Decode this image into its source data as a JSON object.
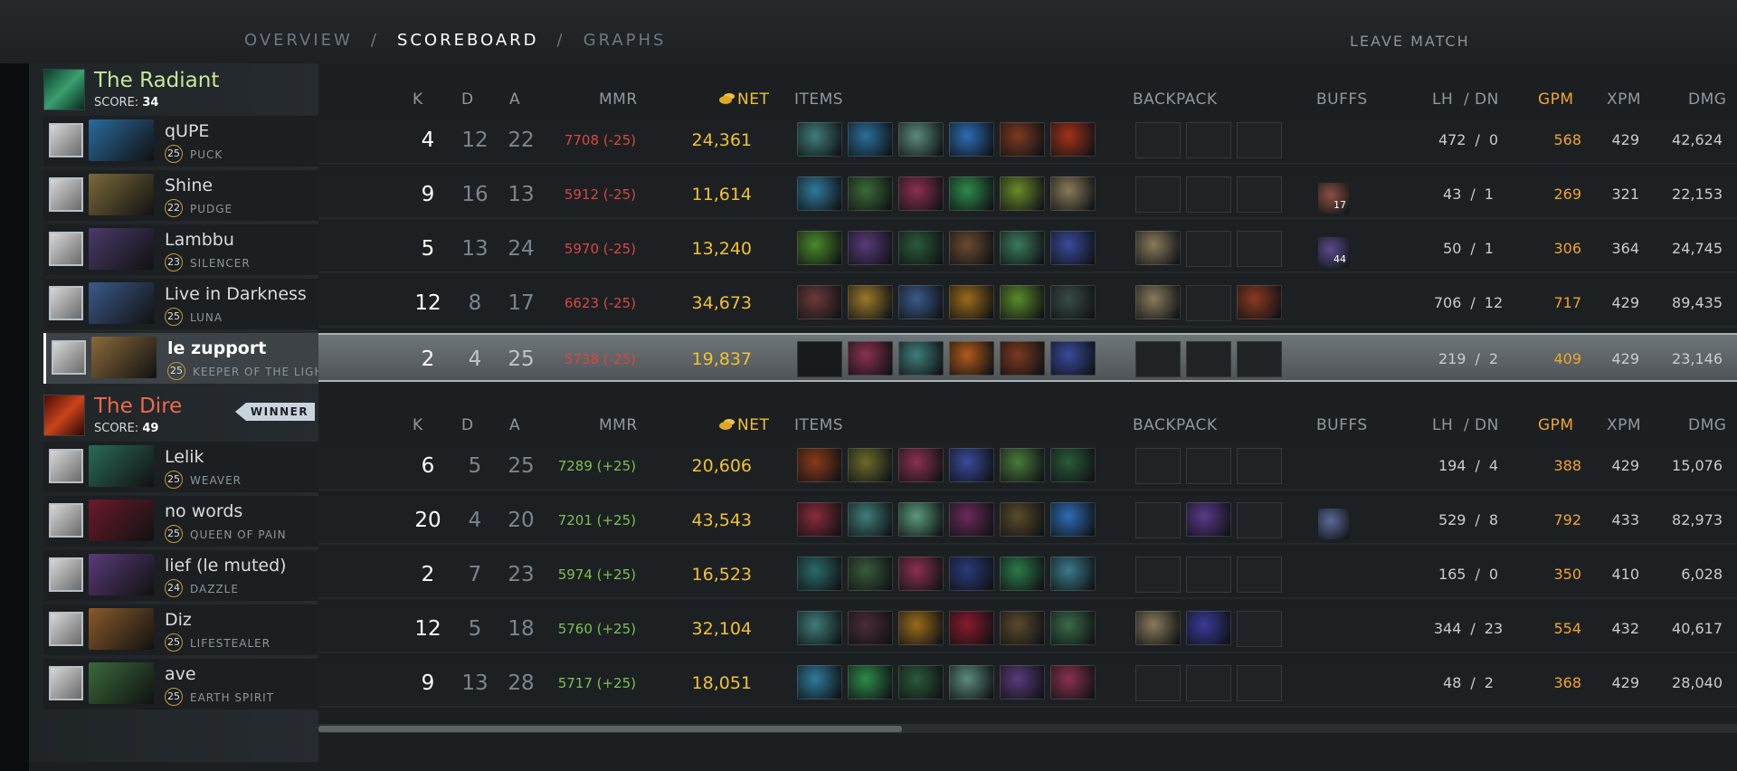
{
  "nav": {
    "overview": "OVERVIEW",
    "sep": "/",
    "scoreboard": "SCOREBOARD",
    "graphs": "GRAPHS",
    "leave": "LEAVE MATCH"
  },
  "columns": {
    "k": "K",
    "d": "D",
    "a": "A",
    "mmr": "MMR",
    "net": "NET",
    "items": "ITEMS",
    "backpack": "BACKPACK",
    "buffs": "BUFFS",
    "lh": "LH",
    "slash": "/",
    "dn": "DN",
    "gpm": "GPM",
    "xpm": "XPM",
    "dmg": "DMG"
  },
  "radiant": {
    "name": "The Radiant",
    "score_label": "SCORE:",
    "score": "34",
    "color": "#c5e89a",
    "players": [
      {
        "name": "qUPE",
        "level": "25",
        "hero": "PUCK",
        "k": "4",
        "d": "12",
        "a": "22",
        "mmr": "7708 (-25)",
        "net": "24,361",
        "lh": "472",
        "dn": "0",
        "gpm": "568",
        "xpm": "429",
        "dmg": "42,624",
        "items": [
          "#3f7d7a",
          "#2a6f9a",
          "#5b8a7e",
          "#2c6db5",
          "#7a3a20",
          "#a33218"
        ],
        "backpack": [
          "",
          "",
          ""
        ],
        "buffs": []
      },
      {
        "name": "Shine",
        "level": "22",
        "hero": "PUDGE",
        "k": "9",
        "d": "16",
        "a": "13",
        "mmr": "5912 (-25)",
        "net": "11,614",
        "lh": "43",
        "dn": "1",
        "gpm": "269",
        "xpm": "321",
        "dmg": "22,153",
        "items": [
          "#2f7a9a",
          "#3c6a38",
          "#8a3050",
          "#2e8a4a",
          "#6a8a2a",
          "#8a7a5a"
        ],
        "backpack": [
          "",
          "",
          ""
        ],
        "buffs": [
          {
            "color": "#8a5040",
            "count": "17"
          }
        ]
      },
      {
        "name": "Lambbu",
        "level": "23",
        "hero": "SILENCER",
        "k": "5",
        "d": "13",
        "a": "24",
        "mmr": "5970 (-25)",
        "net": "13,240",
        "lh": "50",
        "dn": "1",
        "gpm": "306",
        "xpm": "364",
        "dmg": "24,745",
        "items": [
          "#4a8a2a",
          "#5a3a7a",
          "#2a5a3a",
          "#6a4a30",
          "#3a7a5a",
          "#3a4a9a"
        ],
        "backpack": [
          "#8a7a5a",
          "",
          ""
        ],
        "buffs": [
          {
            "color": "#5a4a8a",
            "count": "44"
          }
        ]
      },
      {
        "name": "Live in Darkness",
        "level": "25",
        "hero": "LUNA",
        "k": "12",
        "d": "8",
        "a": "17",
        "mmr": "6623 (-25)",
        "net": "34,673",
        "lh": "706",
        "dn": "12",
        "gpm": "717",
        "xpm": "429",
        "dmg": "89,435",
        "items": [
          "#6a3a3a",
          "#9a7a2a",
          "#3a5a8a",
          "#9a6a1a",
          "#5a8a2a",
          "#3a4a4a"
        ],
        "backpack": [
          "#8a7a5a",
          "",
          "#8a3a20"
        ],
        "buffs": []
      },
      {
        "name": "le zupport",
        "level": "25",
        "hero": "KEEPER OF THE LIGHT",
        "k": "2",
        "d": "4",
        "a": "25",
        "mmr": "5738 (-25)",
        "net": "19,837",
        "lh": "219",
        "dn": "2",
        "gpm": "409",
        "xpm": "429",
        "dmg": "23,146",
        "items": [
          "",
          "#8a3050",
          "#3f7d7a",
          "#b05a1a",
          "#7a3a20",
          "#3a4a9a"
        ],
        "backpack": [
          "",
          "",
          ""
        ],
        "buffs": []
      }
    ]
  },
  "dire": {
    "name": "The Dire",
    "score_label": "SCORE:",
    "score": "49",
    "winner": "WINNER",
    "color": "#ec6a4a",
    "players": [
      {
        "name": "Lelik",
        "level": "25",
        "hero": "WEAVER",
        "k": "6",
        "d": "5",
        "a": "25",
        "mmr": "7289 (+25)",
        "net": "20,606",
        "lh": "194",
        "dn": "4",
        "gpm": "388",
        "xpm": "429",
        "dmg": "15,076",
        "items": [
          "#8a3a1a",
          "#6a6a2a",
          "#8a3050",
          "#3a4a9a",
          "#4a7a3a",
          "#2a5a3a"
        ],
        "backpack": [
          "",
          "",
          ""
        ],
        "buffs": []
      },
      {
        "name": "no words",
        "level": "25",
        "hero": "QUEEN OF PAIN",
        "k": "20",
        "d": "4",
        "a": "20",
        "mmr": "7201 (+25)",
        "net": "43,543",
        "lh": "529",
        "dn": "8",
        "gpm": "792",
        "xpm": "433",
        "dmg": "82,973",
        "items": [
          "#8a2a3a",
          "#3f7d7a",
          "#5a9a7a",
          "#6a2a5a",
          "#5a4a2a",
          "#2c6db5"
        ],
        "backpack": [
          "",
          "#5a3a8a",
          ""
        ],
        "buffs": [
          {
            "color": "#5a6a9a",
            "count": ""
          }
        ]
      },
      {
        "name": "lief (le muted)",
        "level": "24",
        "hero": "DAZZLE",
        "k": "2",
        "d": "7",
        "a": "23",
        "mmr": "5974 (+25)",
        "net": "16,523",
        "lh": "165",
        "dn": "0",
        "gpm": "350",
        "xpm": "410",
        "dmg": "6,028",
        "items": [
          "#2a6a6a",
          "#3a5a3a",
          "#8a3050",
          "#2a3a7a",
          "#2a7a4a",
          "#3a7a8a"
        ],
        "backpack": [
          "",
          "",
          ""
        ],
        "buffs": []
      },
      {
        "name": "Diz",
        "level": "25",
        "hero": "LIFESTEALER",
        "k": "12",
        "d": "5",
        "a": "18",
        "mmr": "5760 (+25)",
        "net": "32,104",
        "lh": "344",
        "dn": "23",
        "gpm": "554",
        "xpm": "432",
        "dmg": "40,617",
        "items": [
          "#3f7d7a",
          "#4a2a3a",
          "#9a6a1a",
          "#8a1a2a",
          "#5a4a2a",
          "#3a6a4a"
        ],
        "backpack": [
          "#8a7a5a",
          "#3a3a9a",
          ""
        ],
        "buffs": []
      },
      {
        "name": "ave",
        "level": "25",
        "hero": "EARTH SPIRIT",
        "k": "9",
        "d": "13",
        "a": "28",
        "mmr": "5717 (+25)",
        "net": "18,051",
        "lh": "48",
        "dn": "2",
        "gpm": "368",
        "xpm": "429",
        "dmg": "28,040",
        "items": [
          "#2f7a9a",
          "#2e8a4a",
          "#2a5a3a",
          "#5b8a7e",
          "#5a3a7a",
          "#8a3050"
        ],
        "backpack": [
          "",
          "",
          ""
        ],
        "buffs": []
      }
    ]
  }
}
